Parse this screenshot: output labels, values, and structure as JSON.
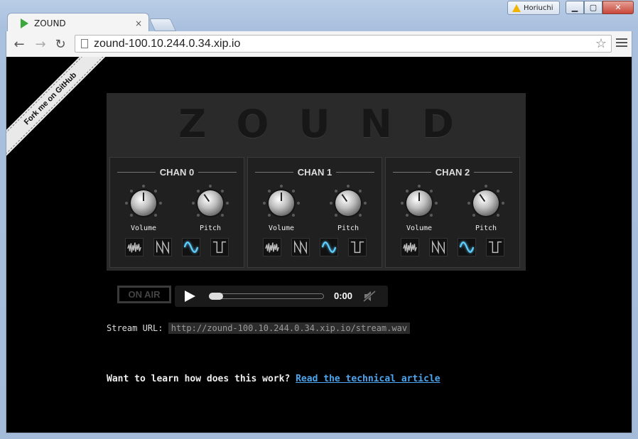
{
  "window": {
    "user_name": "Horiuchi",
    "min_label": "▁",
    "max_label": "▢",
    "close_label": "✕"
  },
  "tab": {
    "title": "ZOUND",
    "close": "×"
  },
  "toolbar": {
    "back": "←",
    "forward": "→",
    "reload": "↻",
    "url": "zound-100.10.244.0.34.xip.io",
    "star": "☆"
  },
  "ribbon": {
    "label": "Fork me on GitHub"
  },
  "synth": {
    "logo_letters": [
      "Z",
      "O",
      "U",
      "N",
      "D"
    ],
    "channels": [
      {
        "name": "CHAN 0",
        "volume_label": "Volume",
        "pitch_label": "Pitch",
        "active_wave": "sine"
      },
      {
        "name": "CHAN 1",
        "volume_label": "Volume",
        "pitch_label": "Pitch",
        "active_wave": "sine"
      },
      {
        "name": "CHAN 2",
        "volume_label": "Volume",
        "pitch_label": "Pitch",
        "active_wave": "sine"
      }
    ],
    "waveforms": [
      "noise-icon",
      "sawtooth-icon",
      "sine-icon",
      "square-icon"
    ],
    "colors": {
      "active_wave": "#5fd0ff",
      "inactive_wave": "#bbbbbb"
    }
  },
  "player": {
    "onair_label": "ON AIR",
    "time": "0:00"
  },
  "stream": {
    "label": "Stream URL:",
    "url": "http://zound-100.10.244.0.34.xip.io/stream.wav"
  },
  "learn": {
    "text": "Want to learn how does this work?",
    "link": "Read the technical article"
  }
}
